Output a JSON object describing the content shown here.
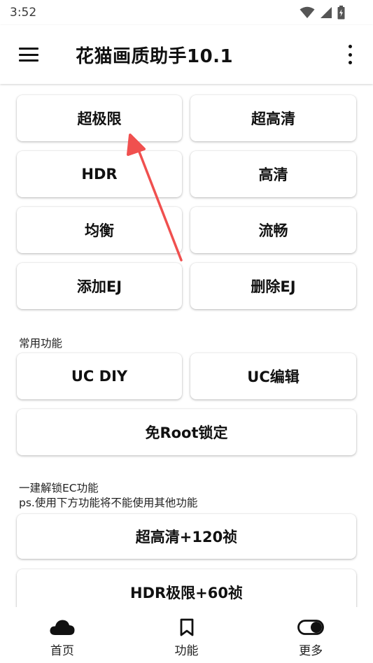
{
  "status_bar": {
    "time": "3:52"
  },
  "app_bar": {
    "title": "花猫画质助手10.1"
  },
  "quality_buttons": [
    {
      "label": "超极限"
    },
    {
      "label": "超高清"
    },
    {
      "label": "HDR"
    },
    {
      "label": "高清"
    },
    {
      "label": "均衡"
    },
    {
      "label": "流畅"
    },
    {
      "label": "添加EJ"
    },
    {
      "label": "删除EJ"
    }
  ],
  "common_section": {
    "label": "常用功能",
    "buttons": [
      {
        "label": "UC DIY"
      },
      {
        "label": "UC编辑"
      },
      {
        "label": "免Root锁定"
      }
    ]
  },
  "ec_section": {
    "label_line1": "一建解锁EC功能",
    "label_line2": "ps.使用下方功能将不能使用其他功能",
    "buttons": [
      {
        "label": "超高清+120祯"
      },
      {
        "label": "HDR极限+60祯"
      }
    ]
  },
  "bottom_nav": {
    "items": [
      {
        "label": "首页",
        "icon": "cloud-icon"
      },
      {
        "label": "功能",
        "icon": "bookmark-icon"
      },
      {
        "label": "更多",
        "icon": "toggle-icon"
      }
    ]
  },
  "colors": {
    "annotation_arrow": "#f0504f",
    "text": "#111111",
    "background": "#ffffff"
  }
}
